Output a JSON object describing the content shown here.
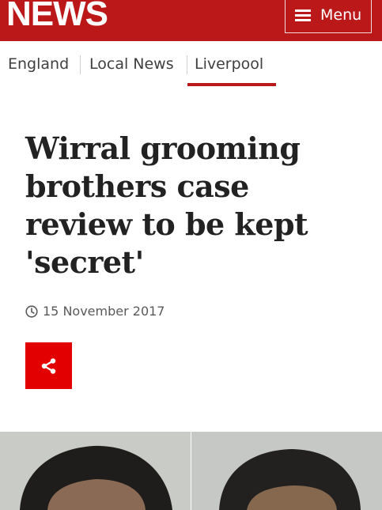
{
  "header": {
    "logo_text": "NEWS",
    "menu_label": "Menu",
    "brand_color": "#bb1919"
  },
  "nav": {
    "items": [
      {
        "label": "England"
      },
      {
        "label": "Local News"
      },
      {
        "label": "Liverpool"
      }
    ],
    "active_item": "Liverpool"
  },
  "article": {
    "headline": "Wirral grooming brothers case review to be kept 'secret'",
    "date": "15 November 2017",
    "share_icon": "share-icon",
    "share_color": "#e30000"
  },
  "media": {
    "photos": [
      "mugshot-left",
      "mugshot-right"
    ]
  }
}
